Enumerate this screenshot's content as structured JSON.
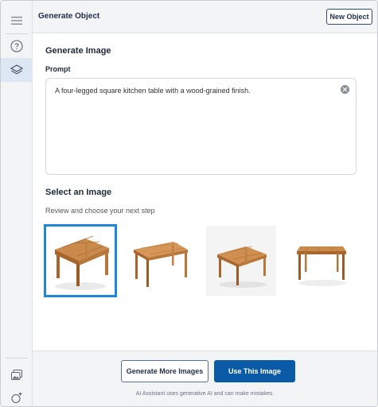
{
  "header": {
    "title": "Generate Object",
    "new_object_label": "New Object"
  },
  "rail": {
    "items": [
      {
        "icon": "menu-icon"
      },
      {
        "icon": "help-icon"
      },
      {
        "icon": "layers-icon",
        "active": true
      },
      {
        "icon": "image-gallery-icon"
      },
      {
        "icon": "ai-sparkle-icon"
      }
    ]
  },
  "generate_image": {
    "title": "Generate Image",
    "prompt_label": "Prompt",
    "prompt_value": "A four-legged square kitchen table with a wood-grained finish."
  },
  "select_image": {
    "title": "Select an Image",
    "subtitle": "Review and choose your next step",
    "selected_index": 0
  },
  "footer": {
    "generate_more_label": "Generate More Images",
    "use_image_label": "Use This Image",
    "disclaimer": "AI Assistant uses generative AI and can make mistakes."
  },
  "colors": {
    "accent": "#0b5aa8",
    "selection": "#1e88d8",
    "wood": "#c98a4b"
  }
}
